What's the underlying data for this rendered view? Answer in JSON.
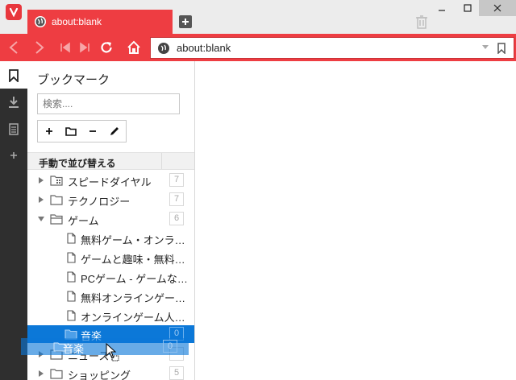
{
  "tab": {
    "title": "about:blank"
  },
  "address": {
    "url": "about:blank"
  },
  "panel": {
    "title": "ブックマーク",
    "search_placeholder": "検索....",
    "sort_label": "手動で並び替える"
  },
  "tree": [
    {
      "label": "スピードダイヤル",
      "count": "7",
      "kind": "speeddial-folder",
      "expanded": false
    },
    {
      "label": "テクノロジー",
      "count": "7",
      "kind": "folder",
      "expanded": false
    },
    {
      "label": "ゲーム",
      "count": "6",
      "kind": "folder",
      "expanded": true
    },
    {
      "label": "無料ゲーム・オンライ…",
      "kind": "page"
    },
    {
      "label": "ゲームと趣味・無料で…",
      "kind": "page"
    },
    {
      "label": "PCゲーム - ゲームな…",
      "kind": "page"
    },
    {
      "label": "無料オンラインゲー…",
      "kind": "page"
    },
    {
      "label": "オンラインゲーム人…",
      "kind": "page"
    },
    {
      "label": "音楽",
      "count": "0",
      "kind": "folder",
      "selected": true
    },
    {
      "label": "ニュース",
      "count": "",
      "kind": "folder",
      "expanded": false
    },
    {
      "label": "ショッピング",
      "count": "5",
      "kind": "folder",
      "expanded": false
    }
  ],
  "drag_ghost": {
    "label": "音楽",
    "count": "0"
  },
  "colors": {
    "accent": "#ee3d42",
    "selection": "#0c78d8",
    "strip": "#2f2f2f"
  }
}
